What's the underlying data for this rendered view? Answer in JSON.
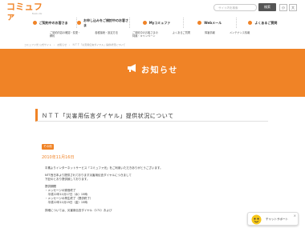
{
  "header": {
    "logo_main": "コミュファ",
    "logo_sub": "from ctc",
    "search_placeholder": "サイト内を検索",
    "search_button": "検索",
    "font_small": "小",
    "font_large": "大"
  },
  "topnav": [
    {
      "label": "ご契約中のお客さま"
    },
    {
      "label": "お申し込みをご検討中のお客さま"
    },
    {
      "label": "Myコミュファ"
    },
    {
      "label": "Webメール"
    },
    {
      "label": "よくあるご質問"
    }
  ],
  "subnav": [
    {
      "line1": "ご契約内容の確認・変更・",
      "line2": "解約"
    },
    {
      "line1": "各種接続・設定方法",
      "line2": ""
    },
    {
      "line1": "ご契約中のお客さまの",
      "line2": "特典・キャンペーン"
    },
    {
      "line1": "よくあるご質問",
      "line2": ""
    },
    {
      "line1": "障害情報",
      "line2": ""
    },
    {
      "line1": "メンテナンス情報",
      "line2": ""
    }
  ],
  "breadcrumb": "コミュファ光 公式サイト　›　お知らせ　›　ＮＴＴ「災害用伝言ダイヤル」提供状況について",
  "hero": {
    "title": "お知らせ"
  },
  "article": {
    "title": "ＮＴＴ「災害用伝言ダイヤル」提供状況について",
    "category": "その他",
    "date": "2010年11月16日",
    "body": [
      "平素よりインターネットサービス「コミュファ光」をご利用いただきありがとうございます。",
      "",
      "NTT西日本より提供されております災害用伝言ダイヤルにつきまして",
      "下記のとおり提供致しております。",
      "",
      "提供期間",
      "・メッセージの録音終了",
      "　平成22年11月17日（水）15時",
      "・メッセージの再生終了（提供終了）",
      "　平成22年11月19日（金）15時",
      "",
      "詳細については、災害用伝言ダイヤル（171）および"
    ]
  },
  "chat": {
    "label": "チャットサポート",
    "close": "×"
  },
  "colors": {
    "accent": "#f08326"
  }
}
